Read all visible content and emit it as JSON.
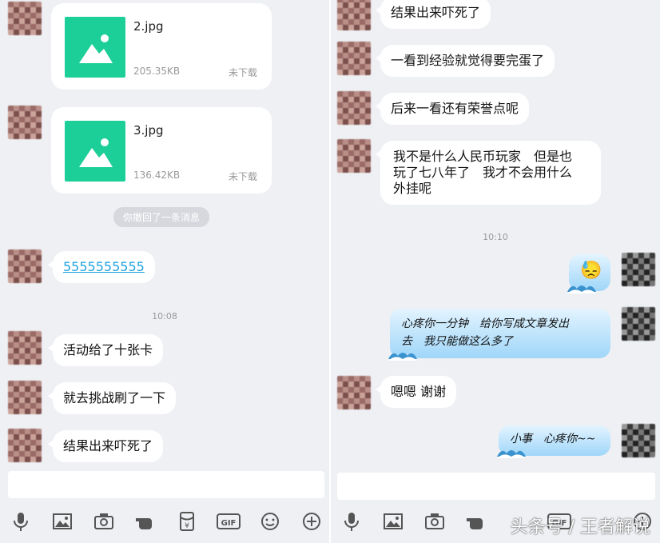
{
  "left": {
    "files": [
      {
        "name": "2.jpg",
        "size": "205.35KB",
        "status": "未下载"
      },
      {
        "name": "3.jpg",
        "size": "136.42KB",
        "status": "未下载"
      }
    ],
    "recall_notice": "你撤回了一条消息",
    "link_message": "5555555555",
    "timestamp": "10:08",
    "messages": [
      "活动给了十张卡",
      "就去挑战刷了一下",
      "结果出来吓死了"
    ]
  },
  "right": {
    "messages_top": [
      "结果出来吓死了",
      "一看到经验就觉得要完蛋了",
      "后来一看还有荣誉点呢"
    ],
    "long_message": [
      "我不是什么人民币玩家　但是也",
      "玩了七八年了　我才不会用什么",
      "外挂呢"
    ],
    "timestamp": "10:10",
    "emoji": "😓",
    "sent_message_1": [
      "心疼你一分钟　给你写成文章发出",
      "去　我只能做这么多了"
    ],
    "reply": "嗯嗯  谢谢",
    "sent_message_2": "小事　心疼你~~"
  },
  "watermark": "头条号 / 王者解说",
  "toolbar_icons": [
    "microphone-icon",
    "image-icon",
    "camera-icon",
    "hand-icon",
    "red-packet-icon",
    "gif-icon",
    "emoji-icon",
    "plus-icon"
  ]
}
